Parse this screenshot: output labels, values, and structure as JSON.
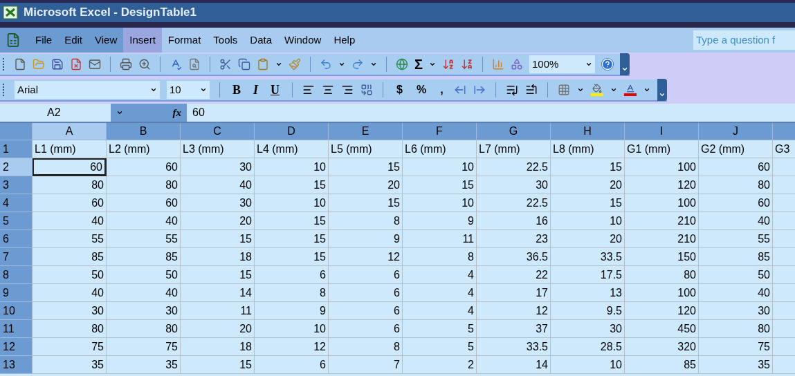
{
  "window": {
    "title": "Microsoft Excel - DesignTable1"
  },
  "menu": [
    {
      "label": "File",
      "hovered": false
    },
    {
      "label": "Edit",
      "hovered": false
    },
    {
      "label": "View",
      "hovered": false
    },
    {
      "label": "Insert",
      "hovered": true
    },
    {
      "label": "Format",
      "hovered": false
    },
    {
      "label": "Tools",
      "hovered": false
    },
    {
      "label": "Data",
      "hovered": false
    },
    {
      "label": "Window",
      "hovered": false
    },
    {
      "label": "Help",
      "hovered": false
    }
  ],
  "question_box": {
    "placeholder": "Type a question f"
  },
  "standard_toolbar": {
    "sum": "Σ",
    "zoom": "100%"
  },
  "formatting_toolbar": {
    "font": "Arial",
    "size": "10",
    "style_buttons": [
      "B",
      "I",
      "U"
    ],
    "number_buttons": [
      "$",
      "%",
      ","
    ]
  },
  "formula_bar": {
    "name_box": "A2",
    "fx": "fx",
    "value": "60"
  },
  "sheet": {
    "columns": [
      {
        "label": "A",
        "selected": true
      },
      {
        "label": "B",
        "selected": false
      },
      {
        "label": "C",
        "selected": false
      },
      {
        "label": "D",
        "selected": false
      },
      {
        "label": "E",
        "selected": false
      },
      {
        "label": "F",
        "selected": false
      },
      {
        "label": "G",
        "selected": false
      },
      {
        "label": "H",
        "selected": false
      },
      {
        "label": "I",
        "selected": false
      },
      {
        "label": "J",
        "selected": false
      }
    ],
    "rows": [
      {
        "header": "1",
        "kind": "labels",
        "selected": false,
        "cells": [
          "L1 (mm)",
          "L2 (mm)",
          "L3 (mm)",
          "L4 (mm)",
          "L5 (mm)",
          "L6 (mm)",
          "L7 (mm)",
          "L8 (mm)",
          "G1 (mm)",
          "G2 (mm)",
          "G3"
        ]
      },
      {
        "header": "2",
        "kind": "values",
        "selected": true,
        "cells": [
          "60",
          "60",
          "30",
          "10",
          "15",
          "10",
          "22.5",
          "15",
          "100",
          "60"
        ]
      },
      {
        "header": "3",
        "kind": "values",
        "selected": false,
        "cells": [
          "80",
          "80",
          "40",
          "15",
          "20",
          "15",
          "30",
          "20",
          "120",
          "80"
        ]
      },
      {
        "header": "4",
        "kind": "values",
        "selected": false,
        "cells": [
          "60",
          "60",
          "30",
          "10",
          "15",
          "10",
          "22.5",
          "15",
          "100",
          "60"
        ]
      },
      {
        "header": "5",
        "kind": "values",
        "selected": false,
        "cells": [
          "40",
          "40",
          "20",
          "15",
          "8",
          "9",
          "16",
          "10",
          "210",
          "40"
        ]
      },
      {
        "header": "6",
        "kind": "values",
        "selected": false,
        "cells": [
          "55",
          "55",
          "15",
          "15",
          "9",
          "11",
          "23",
          "20",
          "210",
          "55"
        ]
      },
      {
        "header": "7",
        "kind": "values",
        "selected": false,
        "cells": [
          "85",
          "85",
          "18",
          "15",
          "12",
          "8",
          "36.5",
          "33.5",
          "150",
          "85"
        ]
      },
      {
        "header": "8",
        "kind": "values",
        "selected": false,
        "cells": [
          "50",
          "50",
          "15",
          "6",
          "6",
          "4",
          "22",
          "17.5",
          "80",
          "50"
        ]
      },
      {
        "header": "9",
        "kind": "values",
        "selected": false,
        "cells": [
          "40",
          "40",
          "14",
          "8",
          "6",
          "4",
          "17",
          "13",
          "100",
          "40"
        ]
      },
      {
        "header": "10",
        "kind": "values",
        "selected": false,
        "cells": [
          "30",
          "30",
          "11",
          "9",
          "6",
          "4",
          "12",
          "9.5",
          "120",
          "30"
        ]
      },
      {
        "header": "11",
        "kind": "values",
        "selected": false,
        "cells": [
          "80",
          "80",
          "20",
          "10",
          "6",
          "5",
          "37",
          "30",
          "450",
          "80"
        ]
      },
      {
        "header": "12",
        "kind": "values",
        "selected": false,
        "cells": [
          "75",
          "75",
          "18",
          "12",
          "8",
          "5",
          "33.5",
          "28.5",
          "320",
          "75"
        ]
      },
      {
        "header": "13",
        "kind": "values",
        "selected": false,
        "cells": [
          "35",
          "35",
          "15",
          "6",
          "7",
          "2",
          "14",
          "10",
          "85",
          "35"
        ]
      }
    ]
  }
}
